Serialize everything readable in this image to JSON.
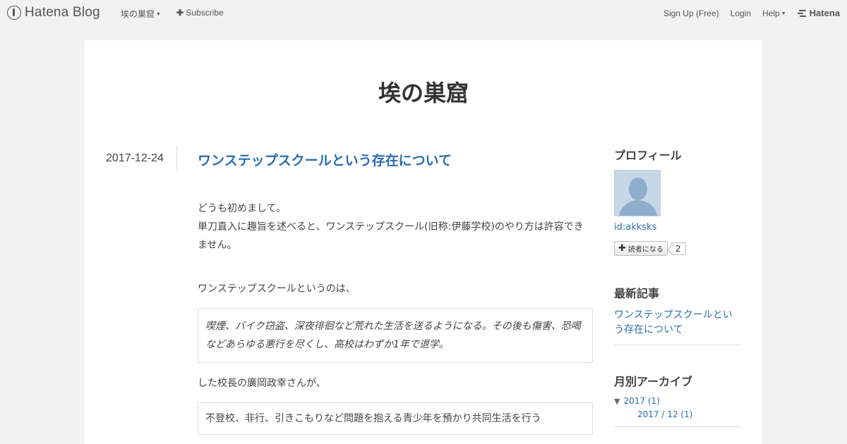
{
  "topbar": {
    "logo_text": "Hatena Blog",
    "blog_menu_label": "埃の巣窟",
    "subscribe_label": "Subscribe",
    "signup_label": "Sign Up (Free)",
    "login_label": "Login",
    "help_label": "Help",
    "brand_label": "Hatena"
  },
  "blog": {
    "title": "埃の巣窟"
  },
  "entry": {
    "date": "2017-12-24",
    "title": "ワンステップスクールという存在について",
    "paragraphs": [
      "どうも初めまして。",
      "単刀直入に趣旨を述べると、ワンステップスクール(旧称:伊藤学校)のやり方は許容できません。",
      "ワンステップスクールというのは、",
      "した校長の廣岡政幸さんが、"
    ],
    "quotes": [
      "喫煙、バイク窃盗、深夜徘徊など荒れた生活を送るようになる。その後も傷害、恐喝などあらゆる悪行を尽くし、高校はわずか1年で退学。",
      "不登校、非行、引きこもりなど問題を抱える青少年を預かり共同生活を行う"
    ]
  },
  "sidebar": {
    "profile_heading": "プロフィール",
    "user_id": "id:akksks",
    "follow_label": "読者になる",
    "follow_count": "2",
    "recent_heading": "最新記事",
    "recent_items": [
      "ワンステップスクールという存在について"
    ],
    "archive_heading": "月別アーカイブ",
    "archive_year": "2017 (1)",
    "archive_month": "2017 / 12 (1)"
  },
  "icons": {
    "logo": "hatena-blog-logo-icon",
    "subscribe": "plus-icon",
    "caret": "caret-down-icon",
    "brand": "hatena-brand-icon",
    "avatar": "default-avatar-icon",
    "archive_toggle": "triangle-down-icon"
  },
  "colors": {
    "link": "#2b6cb0",
    "background": "#f2f2f2",
    "card": "#ffffff"
  }
}
